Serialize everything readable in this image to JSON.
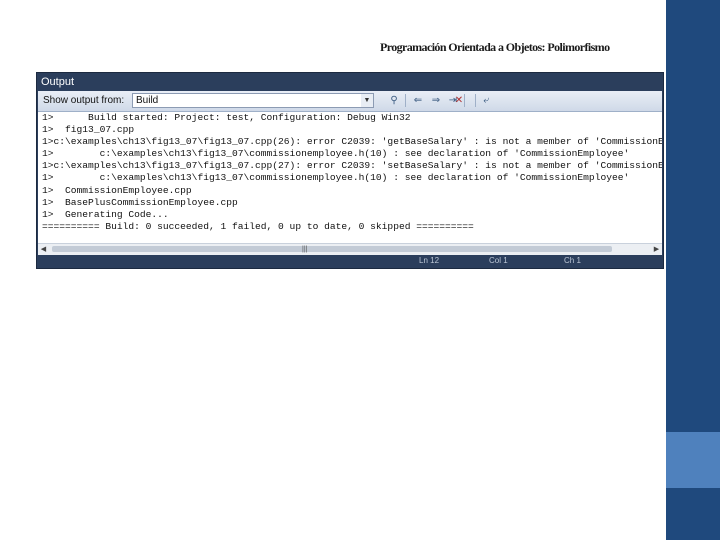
{
  "slide": {
    "title": "Programación Orientada a Objetos: Polimorfismo"
  },
  "output_window": {
    "title": "Output",
    "toolbar": {
      "show_output_label": "Show output from:",
      "source_value": "Build"
    },
    "lines": [
      "1>      Build started: Project: test, Configuration: Debug Win32",
      "1>  fig13_07.cpp",
      "1>c:\\examples\\ch13\\fig13_07\\fig13_07.cpp(26): error C2039: 'getBaseSalary' : is not a member of 'CommissionE",
      "1>        c:\\examples\\ch13\\fig13_07\\commissionemployee.h(10) : see declaration of 'CommissionEmployee'",
      "1>c:\\examples\\ch13\\fig13_07\\fig13_07.cpp(27): error C2039: 'setBaseSalary' : is not a member of 'CommissionE",
      "1>        c:\\examples\\ch13\\fig13_07\\commissionemployee.h(10) : see declaration of 'CommissionEmployee'",
      "1>  CommissionEmployee.cpp",
      "1>  BasePlusCommissionEmployee.cpp",
      "1>  Generating Code...",
      "========== Build: 0 succeeded, 1 failed, 0 up to date, 0 skipped =========="
    ],
    "behind_tabs": [
      "Ln 12",
      "Col 1",
      "Ch 1"
    ]
  }
}
